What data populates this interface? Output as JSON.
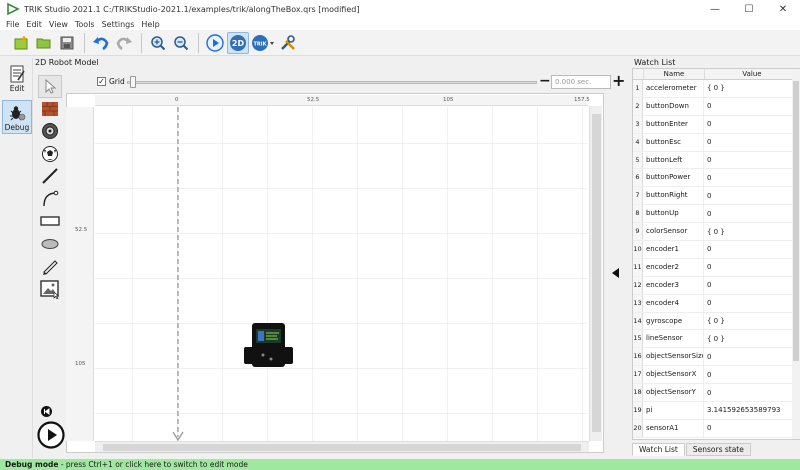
{
  "window": {
    "title": "TRIK Studio 2021.1 C:/TRIKStudio-2021.1/examples/trik/alongTheBox.qrs [modified]",
    "minimize": "—",
    "maximize": "☐",
    "close": "✕"
  },
  "menu": [
    "File",
    "Edit",
    "View",
    "Tools",
    "Settings",
    "Help"
  ],
  "toolbar": {
    "icons": [
      "new-project-icon",
      "open-icon",
      "save-icon",
      "undo-icon",
      "redo-icon",
      "zoom-in-icon",
      "zoom-out-icon",
      "run-icon",
      "2d-model-icon",
      "trik-robot-icon",
      "settings-icon"
    ],
    "btn_2d": "2D",
    "btn_trik": "TRIK"
  },
  "modes": [
    {
      "label": "Edit",
      "active": false
    },
    {
      "label": "Debug",
      "active": true
    }
  ],
  "panel_title": "2D Robot Model",
  "palette": [
    "cursor-icon",
    "wall-icon",
    "skittle-icon",
    "ball-icon",
    "line-icon",
    "curve-icon",
    "rectangle-icon",
    "ellipse-icon",
    "pencil-icon",
    "image-icon"
  ],
  "grid": {
    "label": "Grid",
    "checked": true
  },
  "time_field": "0.000 sec.",
  "zoom_in": "+",
  "zoom_out": "−",
  "ruler": {
    "top": [
      "0",
      "52.5",
      "105",
      "157.5"
    ],
    "left": [
      "52.5",
      "105"
    ]
  },
  "watch": {
    "title": "Watch List",
    "col_name": "Name",
    "col_value": "Value",
    "rows": [
      {
        "n": "1",
        "name": "accelerometer",
        "value": "{ 0 }"
      },
      {
        "n": "2",
        "name": "buttonDown",
        "value": "0"
      },
      {
        "n": "3",
        "name": "buttonEnter",
        "value": "0"
      },
      {
        "n": "4",
        "name": "buttonEsc",
        "value": "0"
      },
      {
        "n": "5",
        "name": "buttonLeft",
        "value": "0"
      },
      {
        "n": "6",
        "name": "buttonPower",
        "value": "0"
      },
      {
        "n": "7",
        "name": "buttonRight",
        "value": "0"
      },
      {
        "n": "8",
        "name": "buttonUp",
        "value": "0"
      },
      {
        "n": "9",
        "name": "colorSensor",
        "value": "{ 0 }"
      },
      {
        "n": "10",
        "name": "encoder1",
        "value": "0"
      },
      {
        "n": "11",
        "name": "encoder2",
        "value": "0"
      },
      {
        "n": "12",
        "name": "encoder3",
        "value": "0"
      },
      {
        "n": "13",
        "name": "encoder4",
        "value": "0"
      },
      {
        "n": "14",
        "name": "gyroscope",
        "value": "{ 0 }"
      },
      {
        "n": "15",
        "name": "lineSensor",
        "value": "{ 0 }"
      },
      {
        "n": "16",
        "name": "objectSensorSize",
        "value": "0"
      },
      {
        "n": "17",
        "name": "objectSensorX",
        "value": "0"
      },
      {
        "n": "18",
        "name": "objectSensorY",
        "value": "0"
      },
      {
        "n": "19",
        "name": "pi",
        "value": "3.141592653589793"
      },
      {
        "n": "20",
        "name": "sensorA1",
        "value": "0"
      }
    ]
  },
  "tabs": [
    {
      "label": "Watch List",
      "active": true
    },
    {
      "label": "Sensors state",
      "active": false
    }
  ],
  "status": {
    "mode": "Debug mode",
    "text": " - press Ctrl+1 or click here to switch to edit mode"
  },
  "colors": {
    "status_bg": "#9fe89f",
    "accent": "#1e6fd9",
    "robot": "#111111"
  }
}
